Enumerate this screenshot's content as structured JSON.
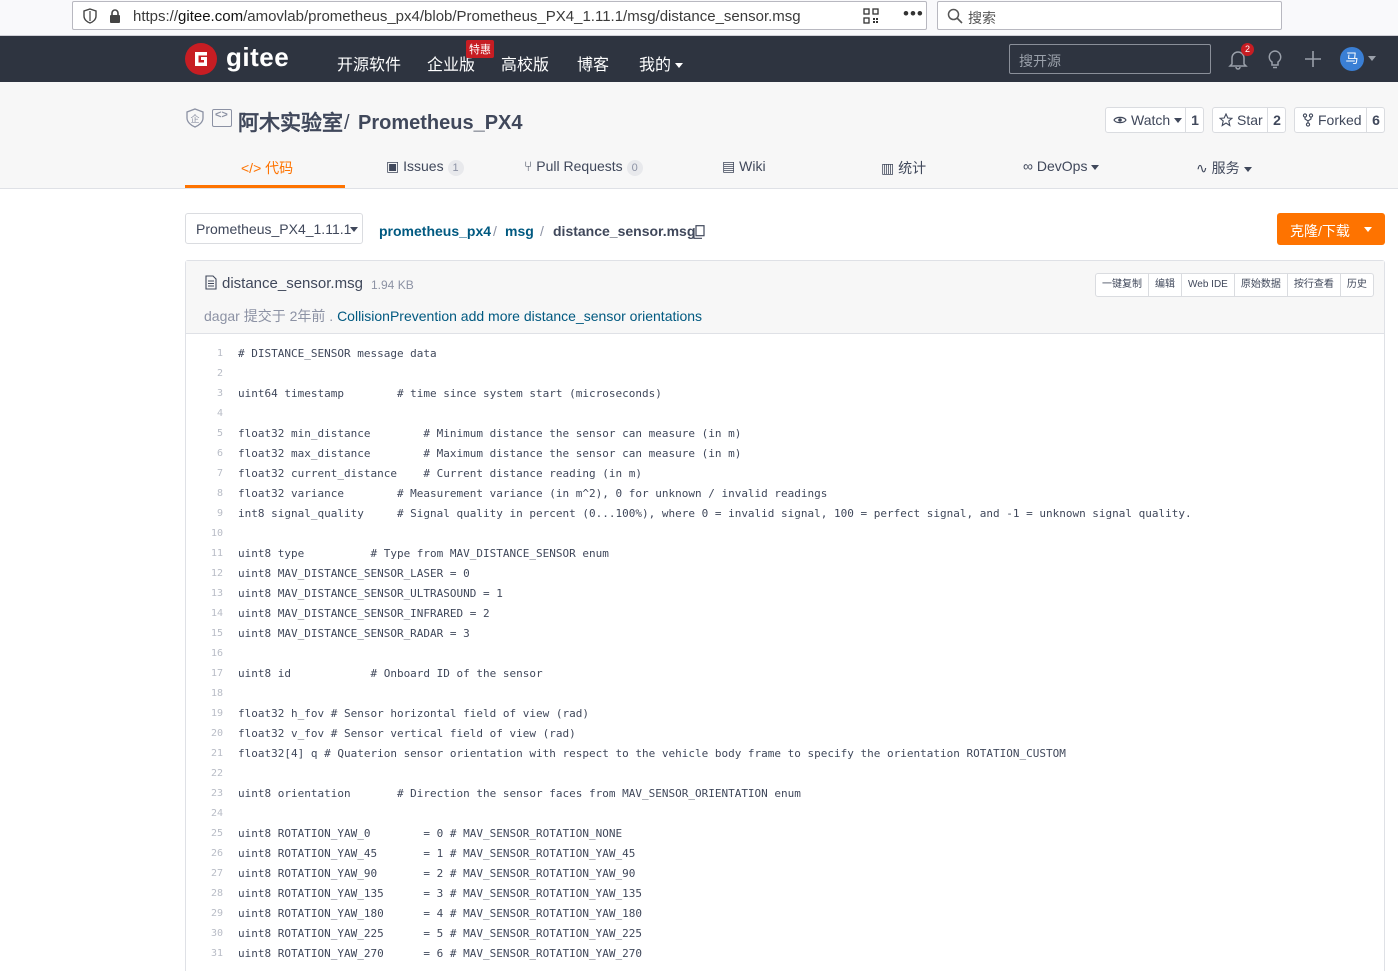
{
  "browser": {
    "url_prefix": "https://",
    "url_host": "gitee.com",
    "url_path": "/amovlab/prometheus_px4/blob/Prometheus_PX4_1.11.1/msg/distance_sensor.msg",
    "search_placeholder": "搜索"
  },
  "header": {
    "logo": "gitee",
    "nav": [
      "开源软件",
      "企业版",
      "高校版",
      "博客",
      "我的"
    ],
    "nav_badge": "特惠",
    "search_placeholder": "搜开源",
    "notification_count": "2",
    "avatar_text": "马"
  },
  "repo": {
    "owner": "阿木实验室",
    "separator": "/",
    "name": "Prometheus_PX4",
    "watch_label": "Watch",
    "watch_count": "1",
    "star_label": "Star",
    "star_count": "2",
    "fork_label": "Forked",
    "fork_count": "6"
  },
  "tabs": {
    "code": "代码",
    "issues": "Issues",
    "issues_count": "1",
    "pulls": "Pull Requests",
    "pulls_count": "0",
    "wiki": "Wiki",
    "stats": "统计",
    "devops": "DevOps",
    "service": "服务"
  },
  "branch": "Prometheus_PX4_1.11.1",
  "breadcrumb": {
    "root": "prometheus_px4",
    "dir": "msg",
    "file": "distance_sensor.msg"
  },
  "clone_label": "克隆/下载",
  "file": {
    "name": "distance_sensor.msg",
    "size": "1.94 KB",
    "author": "dagar",
    "commit_prefix": "提交于",
    "commit_time": "2年前",
    "commit_sep": ".",
    "commit_message": "CollisionPrevention add more distance_sensor orientations",
    "actions": [
      "一键复制",
      "编辑",
      "Web IDE",
      "原始数据",
      "按行查看",
      "历史"
    ]
  },
  "code_lines": [
    "# DISTANCE_SENSOR message data",
    "",
    "uint64 timestamp        # time since system start (microseconds)",
    "",
    "float32 min_distance        # Minimum distance the sensor can measure (in m)",
    "float32 max_distance        # Maximum distance the sensor can measure (in m)",
    "float32 current_distance    # Current distance reading (in m)",
    "float32 variance        # Measurement variance (in m^2), 0 for unknown / invalid readings",
    "int8 signal_quality     # Signal quality in percent (0...100%), where 0 = invalid signal, 100 = perfect signal, and -1 = unknown signal quality.",
    "",
    "uint8 type          # Type from MAV_DISTANCE_SENSOR enum",
    "uint8 MAV_DISTANCE_SENSOR_LASER = 0",
    "uint8 MAV_DISTANCE_SENSOR_ULTRASOUND = 1",
    "uint8 MAV_DISTANCE_SENSOR_INFRARED = 2",
    "uint8 MAV_DISTANCE_SENSOR_RADAR = 3",
    "",
    "uint8 id            # Onboard ID of the sensor",
    "",
    "float32 h_fov # Sensor horizontal field of view (rad)",
    "float32 v_fov # Sensor vertical field of view (rad)",
    "float32[4] q # Quaterion sensor orientation with respect to the vehicle body frame to specify the orientation ROTATION_CUSTOM",
    "",
    "uint8 orientation       # Direction the sensor faces from MAV_SENSOR_ORIENTATION enum",
    "",
    "uint8 ROTATION_YAW_0        = 0 # MAV_SENSOR_ROTATION_NONE",
    "uint8 ROTATION_YAW_45       = 1 # MAV_SENSOR_ROTATION_YAW_45",
    "uint8 ROTATION_YAW_90       = 2 # MAV_SENSOR_ROTATION_YAW_90",
    "uint8 ROTATION_YAW_135      = 3 # MAV_SENSOR_ROTATION_YAW_135",
    "uint8 ROTATION_YAW_180      = 4 # MAV_SENSOR_ROTATION_YAW_180",
    "uint8 ROTATION_YAW_225      = 5 # MAV_SENSOR_ROTATION_YAW_225",
    "uint8 ROTATION_YAW_270      = 6 # MAV_SENSOR_ROTATION_YAW_270"
  ],
  "colors": {
    "accent": "#fe7300",
    "header_bg": "#2e3440",
    "link": "#005980",
    "brand_red": "#c71d23"
  }
}
